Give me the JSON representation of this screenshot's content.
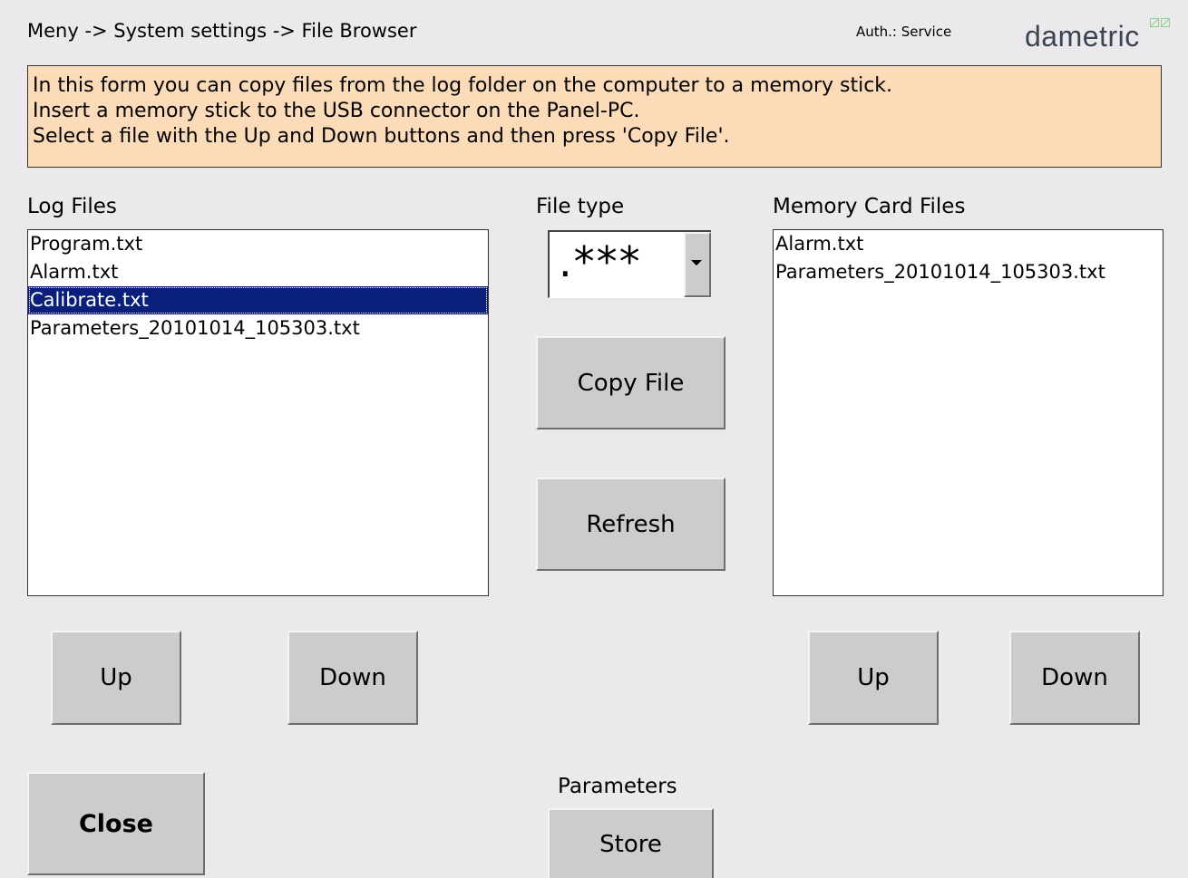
{
  "header": {
    "breadcrumb": "Meny -> System settings -> File Browser",
    "auth": "Auth.: Service",
    "logo": "dametric"
  },
  "info": {
    "lines": [
      "In this form you can copy files from the log folder on the computer to a memory stick.",
      "Insert a memory stick to the USB connector on the Panel-PC.",
      "Select a file with the Up and Down buttons and then press 'Copy File'."
    ]
  },
  "log_files": {
    "label": "Log Files",
    "items": [
      "Program.txt",
      "Alarm.txt",
      "Calibrate.txt",
      "Parameters_20101014_105303.txt"
    ],
    "selected_index": 2,
    "up_label": "Up",
    "down_label": "Down"
  },
  "file_type": {
    "label": "File type",
    "value": ".***"
  },
  "actions": {
    "copy_label": "Copy File",
    "refresh_label": "Refresh"
  },
  "memory_card": {
    "label": "Memory Card Files",
    "items": [
      "Alarm.txt",
      "Parameters_20101014_105303.txt"
    ],
    "up_label": "Up",
    "down_label": "Down"
  },
  "footer": {
    "close_label": "Close",
    "parameters_label": "Parameters",
    "store_label": "Store"
  },
  "colors": {
    "background": "#ebe9eb",
    "info_bg": "#fcdcb8",
    "selection": "#0a1f7a",
    "button": "#cdcbce"
  },
  "icons": {
    "combo_arrow": "chevron-down-icon",
    "logo_mark": "logo-mark-icon"
  }
}
